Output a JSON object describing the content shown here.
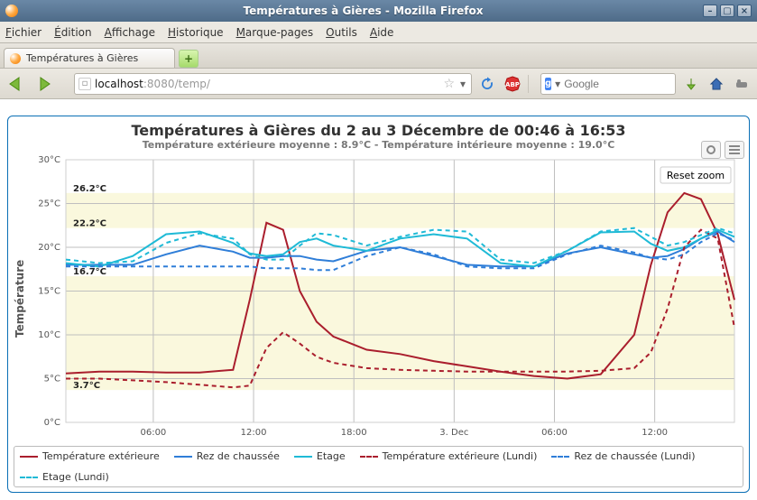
{
  "window": {
    "title": "Températures à Gières - Mozilla Firefox"
  },
  "menu": {
    "items": [
      "Fichier",
      "Édition",
      "Affichage",
      "Historique",
      "Marque-pages",
      "Outils",
      "Aide"
    ]
  },
  "tab": {
    "label": "Températures à Gières"
  },
  "url": {
    "host": "localhost",
    "port": ":8080",
    "path": "/temp/"
  },
  "search": {
    "placeholder": "Google"
  },
  "chart": {
    "title": "Températures à Gières du 2 au 3 Décembre de 00:46 à 16:53",
    "subtitle": "Température extérieure moyenne : 8.9°C - Température intérieure moyenne : 19.0°C",
    "ylabel": "Température",
    "reset_label": "Reset zoom",
    "annotations": {
      "max_ext": "26.2°C",
      "max_int": "22.2°C",
      "min_int": "16.7°C",
      "min_ext": "3.7°C"
    },
    "legend": [
      {
        "key": "ext",
        "label": "Température extérieure",
        "color": "#aa1e2d",
        "dash": false
      },
      {
        "key": "rdc",
        "label": "Rez de chaussée",
        "color": "#2f7ed8",
        "dash": false
      },
      {
        "key": "etage",
        "label": "Etage",
        "color": "#1fbad6",
        "dash": false
      },
      {
        "key": "ext_lundi",
        "label": "Température extérieure (Lundi)",
        "color": "#aa1e2d",
        "dash": true
      },
      {
        "key": "rdc_lundi",
        "label": "Rez de chaussée (Lundi)",
        "color": "#2f7ed8",
        "dash": true
      },
      {
        "key": "etage_lundi",
        "label": "Etage (Lundi)",
        "color": "#1fbad6",
        "dash": true
      }
    ],
    "xticks": [
      "06:00",
      "12:00",
      "18:00",
      "3. Dec",
      "06:00",
      "12:00"
    ],
    "yticks": [
      "0°C",
      "5°C",
      "10°C",
      "15°C",
      "20°C",
      "25°C",
      "30°C"
    ]
  },
  "chart_data": {
    "type": "line",
    "title": "Températures à Gières du 2 au 3 Décembre de 00:46 à 16:53",
    "xlabel": "",
    "ylabel": "Température",
    "ylim": [
      0,
      30
    ],
    "x_unit": "hours since 2 Dec 00:46",
    "x": [
      0,
      2,
      4,
      6,
      8,
      10,
      11,
      12,
      13,
      14,
      15,
      16,
      18,
      20,
      22,
      24,
      26,
      28,
      30,
      32,
      34,
      35,
      36,
      37,
      38,
      39,
      40
    ],
    "series": [
      {
        "name": "Température extérieure",
        "color": "#aa1e2d",
        "dash": false,
        "values": [
          5.6,
          5.8,
          5.8,
          5.7,
          5.7,
          6.0,
          14.0,
          22.8,
          22.0,
          15.0,
          11.5,
          9.8,
          8.3,
          7.8,
          7.0,
          6.4,
          5.8,
          5.3,
          5.0,
          5.5,
          10.0,
          18.0,
          24.0,
          26.2,
          25.5,
          21.5,
          14.0
        ]
      },
      {
        "name": "Rez de chaussée",
        "color": "#2f7ed8",
        "dash": false,
        "values": [
          18.0,
          18.0,
          18.0,
          19.2,
          20.2,
          19.5,
          18.8,
          18.8,
          19.0,
          19.0,
          18.6,
          18.4,
          19.6,
          20.0,
          19.0,
          18.0,
          17.8,
          17.8,
          19.3,
          20.0,
          19.2,
          18.8,
          19.0,
          19.8,
          21.0,
          21.8,
          20.6
        ]
      },
      {
        "name": "Etage",
        "color": "#1fbad6",
        "dash": false,
        "values": [
          18.2,
          17.8,
          19.0,
          21.5,
          21.8,
          20.5,
          19.3,
          19.0,
          19.2,
          20.6,
          21.0,
          20.2,
          19.6,
          21.0,
          21.5,
          21.0,
          18.2,
          17.8,
          19.6,
          21.7,
          21.8,
          20.4,
          19.6,
          20.0,
          21.0,
          22.0,
          21.2
        ]
      },
      {
        "name": "Température extérieure (Lundi)",
        "color": "#aa1e2d",
        "dash": true,
        "values": [
          5.0,
          5.0,
          4.8,
          4.6,
          4.3,
          4.0,
          4.2,
          8.5,
          10.3,
          9.0,
          7.5,
          6.8,
          6.2,
          6.0,
          5.9,
          5.8,
          5.8,
          5.8,
          5.8,
          5.9,
          6.2,
          8.0,
          13.0,
          20.0,
          22.0,
          21.0,
          10.8
        ]
      },
      {
        "name": "Rez de chaussée (Lundi)",
        "color": "#2f7ed8",
        "dash": true,
        "values": [
          17.8,
          17.8,
          17.8,
          17.8,
          17.8,
          17.8,
          17.8,
          17.6,
          17.6,
          17.6,
          17.4,
          17.4,
          19.0,
          20.0,
          19.2,
          17.8,
          17.6,
          17.6,
          19.2,
          20.2,
          19.4,
          18.8,
          18.6,
          19.2,
          20.6,
          21.6,
          20.8
        ]
      },
      {
        "name": "Etage (Lundi)",
        "color": "#1fbad6",
        "dash": true,
        "values": [
          18.6,
          18.2,
          18.4,
          20.5,
          21.6,
          21.0,
          19.2,
          18.6,
          18.6,
          20.2,
          21.6,
          21.4,
          20.2,
          21.2,
          22.0,
          21.8,
          18.6,
          18.2,
          19.6,
          21.8,
          22.2,
          21.2,
          20.2,
          20.6,
          21.4,
          22.2,
          21.6
        ]
      }
    ],
    "bands": [
      {
        "from": 3.7,
        "to": 16.7
      },
      {
        "from": 22.2,
        "to": 26.2
      }
    ],
    "annotations": [
      {
        "y": 26.2,
        "label": "26.2°C"
      },
      {
        "y": 22.2,
        "label": "22.2°C"
      },
      {
        "y": 16.7,
        "label": "16.7°C"
      },
      {
        "y": 3.7,
        "label": "3.7°C"
      }
    ]
  }
}
